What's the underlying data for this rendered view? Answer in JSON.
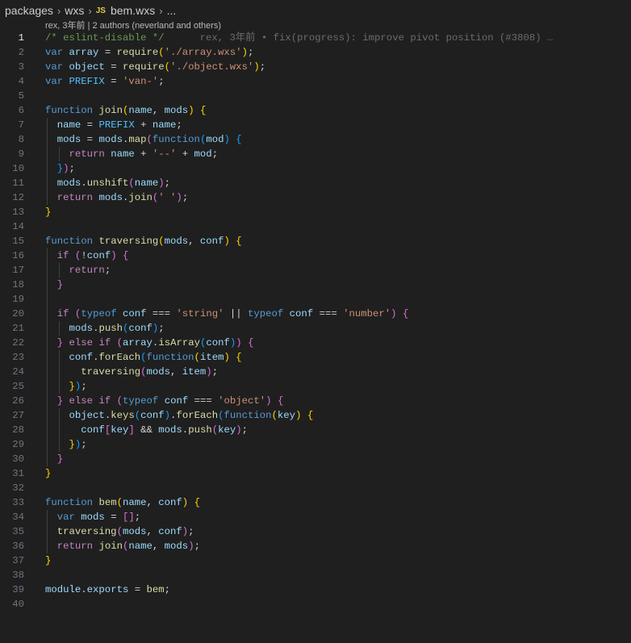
{
  "breadcrumb": {
    "items": [
      "packages",
      "wxs",
      "bem.wxs",
      "..."
    ],
    "file_icon": "JS"
  },
  "codelens": "rex, 3年前 | 2 authors (neverland and others)",
  "blame_inline": "rex, 3年前 • fix(progress): improve pivot position (#3808) …",
  "current_line": 1,
  "lines": [
    [
      [
        "cm",
        "/* eslint-disable */"
      ]
    ],
    [
      [
        "kw",
        "var"
      ],
      [
        "pun",
        " "
      ],
      [
        "var",
        "array"
      ],
      [
        "pun",
        " = "
      ],
      [
        "fn",
        "require"
      ],
      [
        "b1",
        "("
      ],
      [
        "str",
        "'./array.wxs'"
      ],
      [
        "b1",
        ")"
      ],
      [
        "pun",
        ";"
      ]
    ],
    [
      [
        "kw",
        "var"
      ],
      [
        "pun",
        " "
      ],
      [
        "var",
        "object"
      ],
      [
        "pun",
        " = "
      ],
      [
        "fn",
        "require"
      ],
      [
        "b1",
        "("
      ],
      [
        "str",
        "'./object.wxs'"
      ],
      [
        "b1",
        ")"
      ],
      [
        "pun",
        ";"
      ]
    ],
    [
      [
        "kw",
        "var"
      ],
      [
        "pun",
        " "
      ],
      [
        "const",
        "PREFIX"
      ],
      [
        "pun",
        " = "
      ],
      [
        "str",
        "'van-'"
      ],
      [
        "pun",
        ";"
      ]
    ],
    [],
    [
      [
        "kw",
        "function"
      ],
      [
        "pun",
        " "
      ],
      [
        "fn",
        "join"
      ],
      [
        "b1",
        "("
      ],
      [
        "var",
        "name"
      ],
      [
        "pun",
        ", "
      ],
      [
        "var",
        "mods"
      ],
      [
        "b1",
        ")"
      ],
      [
        "pun",
        " "
      ],
      [
        "b1",
        "{"
      ]
    ],
    [
      [
        "pun",
        "  "
      ],
      [
        "var",
        "name"
      ],
      [
        "pun",
        " = "
      ],
      [
        "const",
        "PREFIX"
      ],
      [
        "pun",
        " + "
      ],
      [
        "var",
        "name"
      ],
      [
        "pun",
        ";"
      ]
    ],
    [
      [
        "pun",
        "  "
      ],
      [
        "var",
        "mods"
      ],
      [
        "pun",
        " = "
      ],
      [
        "var",
        "mods"
      ],
      [
        "pun",
        "."
      ],
      [
        "fn",
        "map"
      ],
      [
        "b2",
        "("
      ],
      [
        "kw",
        "function"
      ],
      [
        "b3",
        "("
      ],
      [
        "var",
        "mod"
      ],
      [
        "b3",
        ")"
      ],
      [
        "pun",
        " "
      ],
      [
        "b3",
        "{"
      ]
    ],
    [
      [
        "pun",
        "    "
      ],
      [
        "ctrl",
        "return"
      ],
      [
        "pun",
        " "
      ],
      [
        "var",
        "name"
      ],
      [
        "pun",
        " + "
      ],
      [
        "str",
        "'--'"
      ],
      [
        "pun",
        " + "
      ],
      [
        "var",
        "mod"
      ],
      [
        "pun",
        ";"
      ]
    ],
    [
      [
        "pun",
        "  "
      ],
      [
        "b3",
        "}"
      ],
      [
        "b2",
        ")"
      ],
      [
        "pun",
        ";"
      ]
    ],
    [
      [
        "pun",
        "  "
      ],
      [
        "var",
        "mods"
      ],
      [
        "pun",
        "."
      ],
      [
        "fn",
        "unshift"
      ],
      [
        "b2",
        "("
      ],
      [
        "var",
        "name"
      ],
      [
        "b2",
        ")"
      ],
      [
        "pun",
        ";"
      ]
    ],
    [
      [
        "pun",
        "  "
      ],
      [
        "ctrl",
        "return"
      ],
      [
        "pun",
        " "
      ],
      [
        "var",
        "mods"
      ],
      [
        "pun",
        "."
      ],
      [
        "fn",
        "join"
      ],
      [
        "b2",
        "("
      ],
      [
        "str",
        "' '"
      ],
      [
        "b2",
        ")"
      ],
      [
        "pun",
        ";"
      ]
    ],
    [
      [
        "b1",
        "}"
      ]
    ],
    [],
    [
      [
        "kw",
        "function"
      ],
      [
        "pun",
        " "
      ],
      [
        "fn",
        "traversing"
      ],
      [
        "b1",
        "("
      ],
      [
        "var",
        "mods"
      ],
      [
        "pun",
        ", "
      ],
      [
        "var",
        "conf"
      ],
      [
        "b1",
        ")"
      ],
      [
        "pun",
        " "
      ],
      [
        "b1",
        "{"
      ]
    ],
    [
      [
        "pun",
        "  "
      ],
      [
        "ctrl",
        "if"
      ],
      [
        "pun",
        " "
      ],
      [
        "b2",
        "("
      ],
      [
        "pun",
        "!"
      ],
      [
        "var",
        "conf"
      ],
      [
        "b2",
        ")"
      ],
      [
        "pun",
        " "
      ],
      [
        "b2",
        "{"
      ]
    ],
    [
      [
        "pun",
        "    "
      ],
      [
        "ctrl",
        "return"
      ],
      [
        "pun",
        ";"
      ]
    ],
    [
      [
        "pun",
        "  "
      ],
      [
        "b2",
        "}"
      ]
    ],
    [],
    [
      [
        "pun",
        "  "
      ],
      [
        "ctrl",
        "if"
      ],
      [
        "pun",
        " "
      ],
      [
        "b2",
        "("
      ],
      [
        "kw",
        "typeof"
      ],
      [
        "pun",
        " "
      ],
      [
        "var",
        "conf"
      ],
      [
        "pun",
        " === "
      ],
      [
        "str",
        "'string'"
      ],
      [
        "pun",
        " || "
      ],
      [
        "kw",
        "typeof"
      ],
      [
        "pun",
        " "
      ],
      [
        "var",
        "conf"
      ],
      [
        "pun",
        " === "
      ],
      [
        "str",
        "'number'"
      ],
      [
        "b2",
        ")"
      ],
      [
        "pun",
        " "
      ],
      [
        "b2",
        "{"
      ]
    ],
    [
      [
        "pun",
        "    "
      ],
      [
        "var",
        "mods"
      ],
      [
        "pun",
        "."
      ],
      [
        "fn",
        "push"
      ],
      [
        "b3",
        "("
      ],
      [
        "var",
        "conf"
      ],
      [
        "b3",
        ")"
      ],
      [
        "pun",
        ";"
      ]
    ],
    [
      [
        "pun",
        "  "
      ],
      [
        "b2",
        "}"
      ],
      [
        "pun",
        " "
      ],
      [
        "ctrl",
        "else"
      ],
      [
        "pun",
        " "
      ],
      [
        "ctrl",
        "if"
      ],
      [
        "pun",
        " "
      ],
      [
        "b2",
        "("
      ],
      [
        "var",
        "array"
      ],
      [
        "pun",
        "."
      ],
      [
        "fn",
        "isArray"
      ],
      [
        "b3",
        "("
      ],
      [
        "var",
        "conf"
      ],
      [
        "b3",
        ")"
      ],
      [
        "b2",
        ")"
      ],
      [
        "pun",
        " "
      ],
      [
        "b2",
        "{"
      ]
    ],
    [
      [
        "pun",
        "    "
      ],
      [
        "var",
        "conf"
      ],
      [
        "pun",
        "."
      ],
      [
        "fn",
        "forEach"
      ],
      [
        "b3",
        "("
      ],
      [
        "kw",
        "function"
      ],
      [
        "b1",
        "("
      ],
      [
        "var",
        "item"
      ],
      [
        "b1",
        ")"
      ],
      [
        "pun",
        " "
      ],
      [
        "b1",
        "{"
      ]
    ],
    [
      [
        "pun",
        "      "
      ],
      [
        "fn",
        "traversing"
      ],
      [
        "b2",
        "("
      ],
      [
        "var",
        "mods"
      ],
      [
        "pun",
        ", "
      ],
      [
        "var",
        "item"
      ],
      [
        "b2",
        ")"
      ],
      [
        "pun",
        ";"
      ]
    ],
    [
      [
        "pun",
        "    "
      ],
      [
        "b1",
        "}"
      ],
      [
        "b3",
        ")"
      ],
      [
        "pun",
        ";"
      ]
    ],
    [
      [
        "pun",
        "  "
      ],
      [
        "b2",
        "}"
      ],
      [
        "pun",
        " "
      ],
      [
        "ctrl",
        "else"
      ],
      [
        "pun",
        " "
      ],
      [
        "ctrl",
        "if"
      ],
      [
        "pun",
        " "
      ],
      [
        "b2",
        "("
      ],
      [
        "kw",
        "typeof"
      ],
      [
        "pun",
        " "
      ],
      [
        "var",
        "conf"
      ],
      [
        "pun",
        " === "
      ],
      [
        "str",
        "'object'"
      ],
      [
        "b2",
        ")"
      ],
      [
        "pun",
        " "
      ],
      [
        "b2",
        "{"
      ]
    ],
    [
      [
        "pun",
        "    "
      ],
      [
        "var",
        "object"
      ],
      [
        "pun",
        "."
      ],
      [
        "fn",
        "keys"
      ],
      [
        "b3",
        "("
      ],
      [
        "var",
        "conf"
      ],
      [
        "b3",
        ")"
      ],
      [
        "pun",
        "."
      ],
      [
        "fn",
        "forEach"
      ],
      [
        "b3",
        "("
      ],
      [
        "kw",
        "function"
      ],
      [
        "b1",
        "("
      ],
      [
        "var",
        "key"
      ],
      [
        "b1",
        ")"
      ],
      [
        "pun",
        " "
      ],
      [
        "b1",
        "{"
      ]
    ],
    [
      [
        "pun",
        "      "
      ],
      [
        "var",
        "conf"
      ],
      [
        "b2",
        "["
      ],
      [
        "var",
        "key"
      ],
      [
        "b2",
        "]"
      ],
      [
        "pun",
        " && "
      ],
      [
        "var",
        "mods"
      ],
      [
        "pun",
        "."
      ],
      [
        "fn",
        "push"
      ],
      [
        "b2",
        "("
      ],
      [
        "var",
        "key"
      ],
      [
        "b2",
        ")"
      ],
      [
        "pun",
        ";"
      ]
    ],
    [
      [
        "pun",
        "    "
      ],
      [
        "b1",
        "}"
      ],
      [
        "b3",
        ")"
      ],
      [
        "pun",
        ";"
      ]
    ],
    [
      [
        "pun",
        "  "
      ],
      [
        "b2",
        "}"
      ]
    ],
    [
      [
        "b1",
        "}"
      ]
    ],
    [],
    [
      [
        "kw",
        "function"
      ],
      [
        "pun",
        " "
      ],
      [
        "fn",
        "bem"
      ],
      [
        "b1",
        "("
      ],
      [
        "var",
        "name"
      ],
      [
        "pun",
        ", "
      ],
      [
        "var",
        "conf"
      ],
      [
        "b1",
        ")"
      ],
      [
        "pun",
        " "
      ],
      [
        "b1",
        "{"
      ]
    ],
    [
      [
        "pun",
        "  "
      ],
      [
        "kw",
        "var"
      ],
      [
        "pun",
        " "
      ],
      [
        "var",
        "mods"
      ],
      [
        "pun",
        " = "
      ],
      [
        "b2",
        "[]"
      ],
      [
        "pun",
        ";"
      ]
    ],
    [
      [
        "pun",
        "  "
      ],
      [
        "fn",
        "traversing"
      ],
      [
        "b2",
        "("
      ],
      [
        "var",
        "mods"
      ],
      [
        "pun",
        ", "
      ],
      [
        "var",
        "conf"
      ],
      [
        "b2",
        ")"
      ],
      [
        "pun",
        ";"
      ]
    ],
    [
      [
        "pun",
        "  "
      ],
      [
        "ctrl",
        "return"
      ],
      [
        "pun",
        " "
      ],
      [
        "fn",
        "join"
      ],
      [
        "b2",
        "("
      ],
      [
        "var",
        "name"
      ],
      [
        "pun",
        ", "
      ],
      [
        "var",
        "mods"
      ],
      [
        "b2",
        ")"
      ],
      [
        "pun",
        ";"
      ]
    ],
    [
      [
        "b1",
        "}"
      ]
    ],
    [],
    [
      [
        "var",
        "module"
      ],
      [
        "pun",
        "."
      ],
      [
        "var",
        "exports"
      ],
      [
        "pun",
        " = "
      ],
      [
        "fn",
        "bem"
      ],
      [
        "pun",
        ";"
      ]
    ],
    []
  ]
}
